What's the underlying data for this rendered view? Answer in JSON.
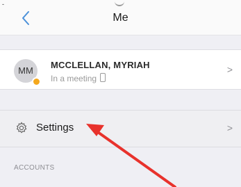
{
  "nav": {
    "status_fragment": "-",
    "title": "Me",
    "back_icon": "chevron-left-icon"
  },
  "profile": {
    "initials": "MM",
    "name": "MCCLELLAN, MYRIAH",
    "status_text": "In a meeting",
    "presence_color": "#f4a81d",
    "chevron": ">"
  },
  "settings": {
    "label": "Settings",
    "icon": "gear-icon",
    "chevron": ">"
  },
  "accounts": {
    "header": "ACCOUNTS"
  },
  "annotation": {
    "arrow_color": "#e8322c"
  }
}
